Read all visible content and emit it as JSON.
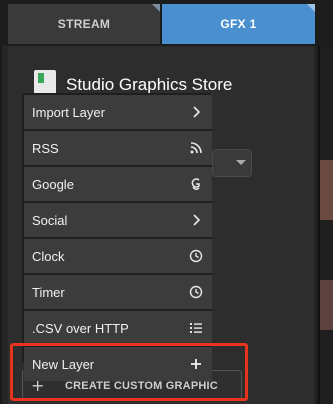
{
  "tabs": [
    {
      "label": "STREAM"
    },
    {
      "label": "GFX 1"
    }
  ],
  "store": {
    "title": "Studio Graphics Store"
  },
  "menu": {
    "items": [
      {
        "label": "Import Layer",
        "icon": "chevron-right-icon"
      },
      {
        "label": "RSS",
        "icon": "rss-icon"
      },
      {
        "label": "Google",
        "icon": "google-icon"
      },
      {
        "label": "Social",
        "icon": "chevron-right-icon"
      },
      {
        "label": "Clock",
        "icon": "clock-icon"
      },
      {
        "label": "Timer",
        "icon": "clock-icon"
      },
      {
        "label": ".CSV over HTTP",
        "icon": "list-icon"
      },
      {
        "label": "New Layer",
        "icon": "plus-icon"
      }
    ]
  },
  "create_button": {
    "plus": "+",
    "label": "CREATE CUSTOM GRAPHIC"
  },
  "colors": {
    "active_tab": "#4a8fd0",
    "highlight": "#e8341c"
  }
}
